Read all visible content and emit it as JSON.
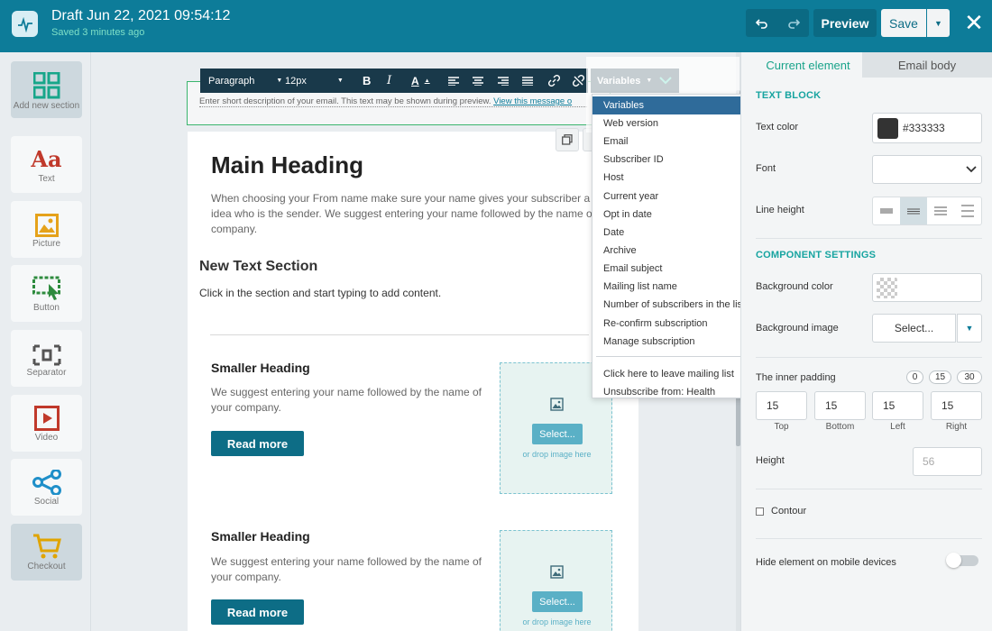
{
  "header": {
    "title": "Draft Jun 22, 2021 09:54:12",
    "saved": "Saved 3 minutes ago",
    "undo_icon": "undo-icon",
    "redo_icon": "redo-icon",
    "preview_label": "Preview",
    "save_label": "Save",
    "close_icon": "close-icon"
  },
  "sidebar": {
    "items": [
      {
        "label": "Add new section",
        "icon": "grid-icon"
      },
      {
        "label": "Text",
        "icon": "text-icon"
      },
      {
        "label": "Picture",
        "icon": "picture-icon"
      },
      {
        "label": "Button",
        "icon": "button-icon"
      },
      {
        "label": "Separator",
        "icon": "separator-icon"
      },
      {
        "label": "Video",
        "icon": "video-icon"
      },
      {
        "label": "Social",
        "icon": "social-icon"
      },
      {
        "label": "Checkout",
        "icon": "cart-icon"
      }
    ]
  },
  "toolbar": {
    "paragraph": "Paragraph",
    "size": "12px",
    "variables_label": "Variables"
  },
  "preheader": {
    "text": "Enter short description of your email. This text may be shown during preview.",
    "link": "View this message o"
  },
  "email": {
    "main_heading": "Main Heading",
    "main_para_1": "When choosing your From name make sure your name gives your subscriber a cle",
    "main_para_2": "idea who is the sender. We suggest entering your name followed by the name of y",
    "main_para_3": "company.",
    "section_heading": "New Text Section",
    "section_para": "Click in the section and start typing to add content.",
    "blocks": [
      {
        "heading": "Smaller Heading",
        "para": "We suggest entering your name followed by the name of your company.",
        "button": "Read more",
        "select": "Select...",
        "drop": "or drop image here"
      },
      {
        "heading": "Smaller Heading",
        "para": "We suggest entering your name followed by the name of your company.",
        "button": "Read more",
        "select": "Select...",
        "drop": "or drop image here"
      }
    ]
  },
  "dropdown": {
    "items": [
      "Variables",
      "Web version",
      "Email",
      "Subscriber ID",
      "Host",
      "Current year",
      "Opt in date",
      "Date",
      "Archive",
      "Email subject",
      "Mailing list name",
      "Number of subscribers in the list",
      "Re-confirm subscription",
      "Manage subscription"
    ],
    "items_after": [
      "Click here to leave mailing list",
      "Unsubscribe from: Health"
    ]
  },
  "panel": {
    "tab_current": "Current element",
    "tab_body": "Email body",
    "text_block": "TEXT BLOCK",
    "text_color_label": "Text color",
    "text_color_value": "#333333",
    "font_label": "Font",
    "line_height_label": "Line height",
    "component_settings": "COMPONENT SETTINGS",
    "bg_color_label": "Background color",
    "bg_image_label": "Background image",
    "bg_image_select": "Select...",
    "inner_padding_label": "The inner padding",
    "pad_presets": [
      "0",
      "15",
      "30"
    ],
    "padding": [
      {
        "label": "Top",
        "value": "15"
      },
      {
        "label": "Bottom",
        "value": "15"
      },
      {
        "label": "Left",
        "value": "15"
      },
      {
        "label": "Right",
        "value": "15"
      }
    ],
    "height_label": "Height",
    "height_value": "56",
    "contour_label": "Contour",
    "hide_mobile_label": "Hide element on mobile devices"
  },
  "colors": {
    "header_bg": "#0d7c99",
    "accent": "#19a38a",
    "button": "#0d6d86",
    "dropdown_selected": "#2f6b9a"
  }
}
